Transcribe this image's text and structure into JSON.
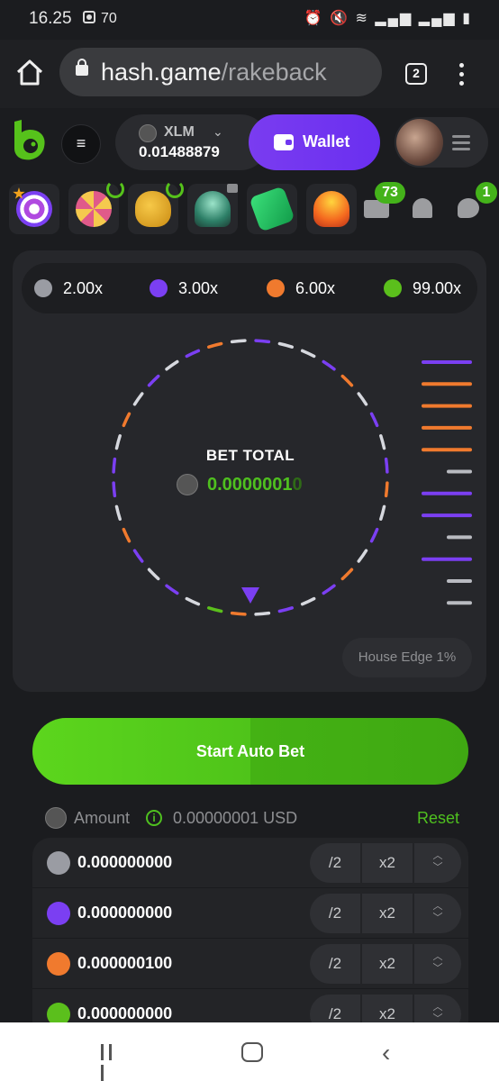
{
  "status_bar": {
    "time": "16.25",
    "notif_count": "70",
    "icons": [
      "alarm-icon",
      "mute-icon",
      "wifi-icon",
      "signal-icon",
      "signal-icon",
      "battery-icon"
    ]
  },
  "browser": {
    "url_host": "hash.game",
    "url_path": "/rakeback",
    "tab_count": "2"
  },
  "header": {
    "currency": "XLM",
    "balance": "0.01488879",
    "wallet_label": "Wallet"
  },
  "games_row": {
    "tiles": [
      "target-icon",
      "wheel-icon",
      "piggy-icon",
      "rocket-icon",
      "cash-icon",
      "coin-stack-icon"
    ],
    "mail_count": "73",
    "chat_count": "1"
  },
  "multipliers": [
    {
      "label": "2.00x",
      "color": "#9a9ca3"
    },
    {
      "label": "3.00x",
      "color": "#7b3ff2"
    },
    {
      "label": "6.00x",
      "color": "#f07a2e"
    },
    {
      "label": "99.00x",
      "color": "#5bbf1c"
    }
  ],
  "wheel": {
    "title": "BET TOTAL",
    "amount_main": "0.0000001",
    "amount_dim": "0"
  },
  "history_colors": [
    "#7b3ff2",
    "#f07a2e",
    "#f07a2e",
    "#f07a2e",
    "#f07a2e",
    "#9a9ca3",
    "#7b3ff2",
    "#7b3ff2",
    "#9a9ca3",
    "#7b3ff2",
    "#9a9ca3",
    "#9a9ca3"
  ],
  "house_edge": "House Edge 1%",
  "start_button": "Start Auto Bet",
  "amount": {
    "label": "Amount",
    "usd_value": "0.00000001 USD",
    "reset_label": "Reset"
  },
  "bets": [
    {
      "color": "#9a9ca3",
      "value": "0.000000000",
      "half": "/2",
      "double": "x2"
    },
    {
      "color": "#7b3ff2",
      "value": "0.000000000",
      "half": "/2",
      "double": "x2"
    },
    {
      "color": "#f07a2e",
      "value": "0.000000100",
      "half": "/2",
      "double": "x2"
    },
    {
      "color": "#5bbf1c",
      "value": "0.000000000",
      "half": "/2",
      "double": "x2"
    }
  ]
}
